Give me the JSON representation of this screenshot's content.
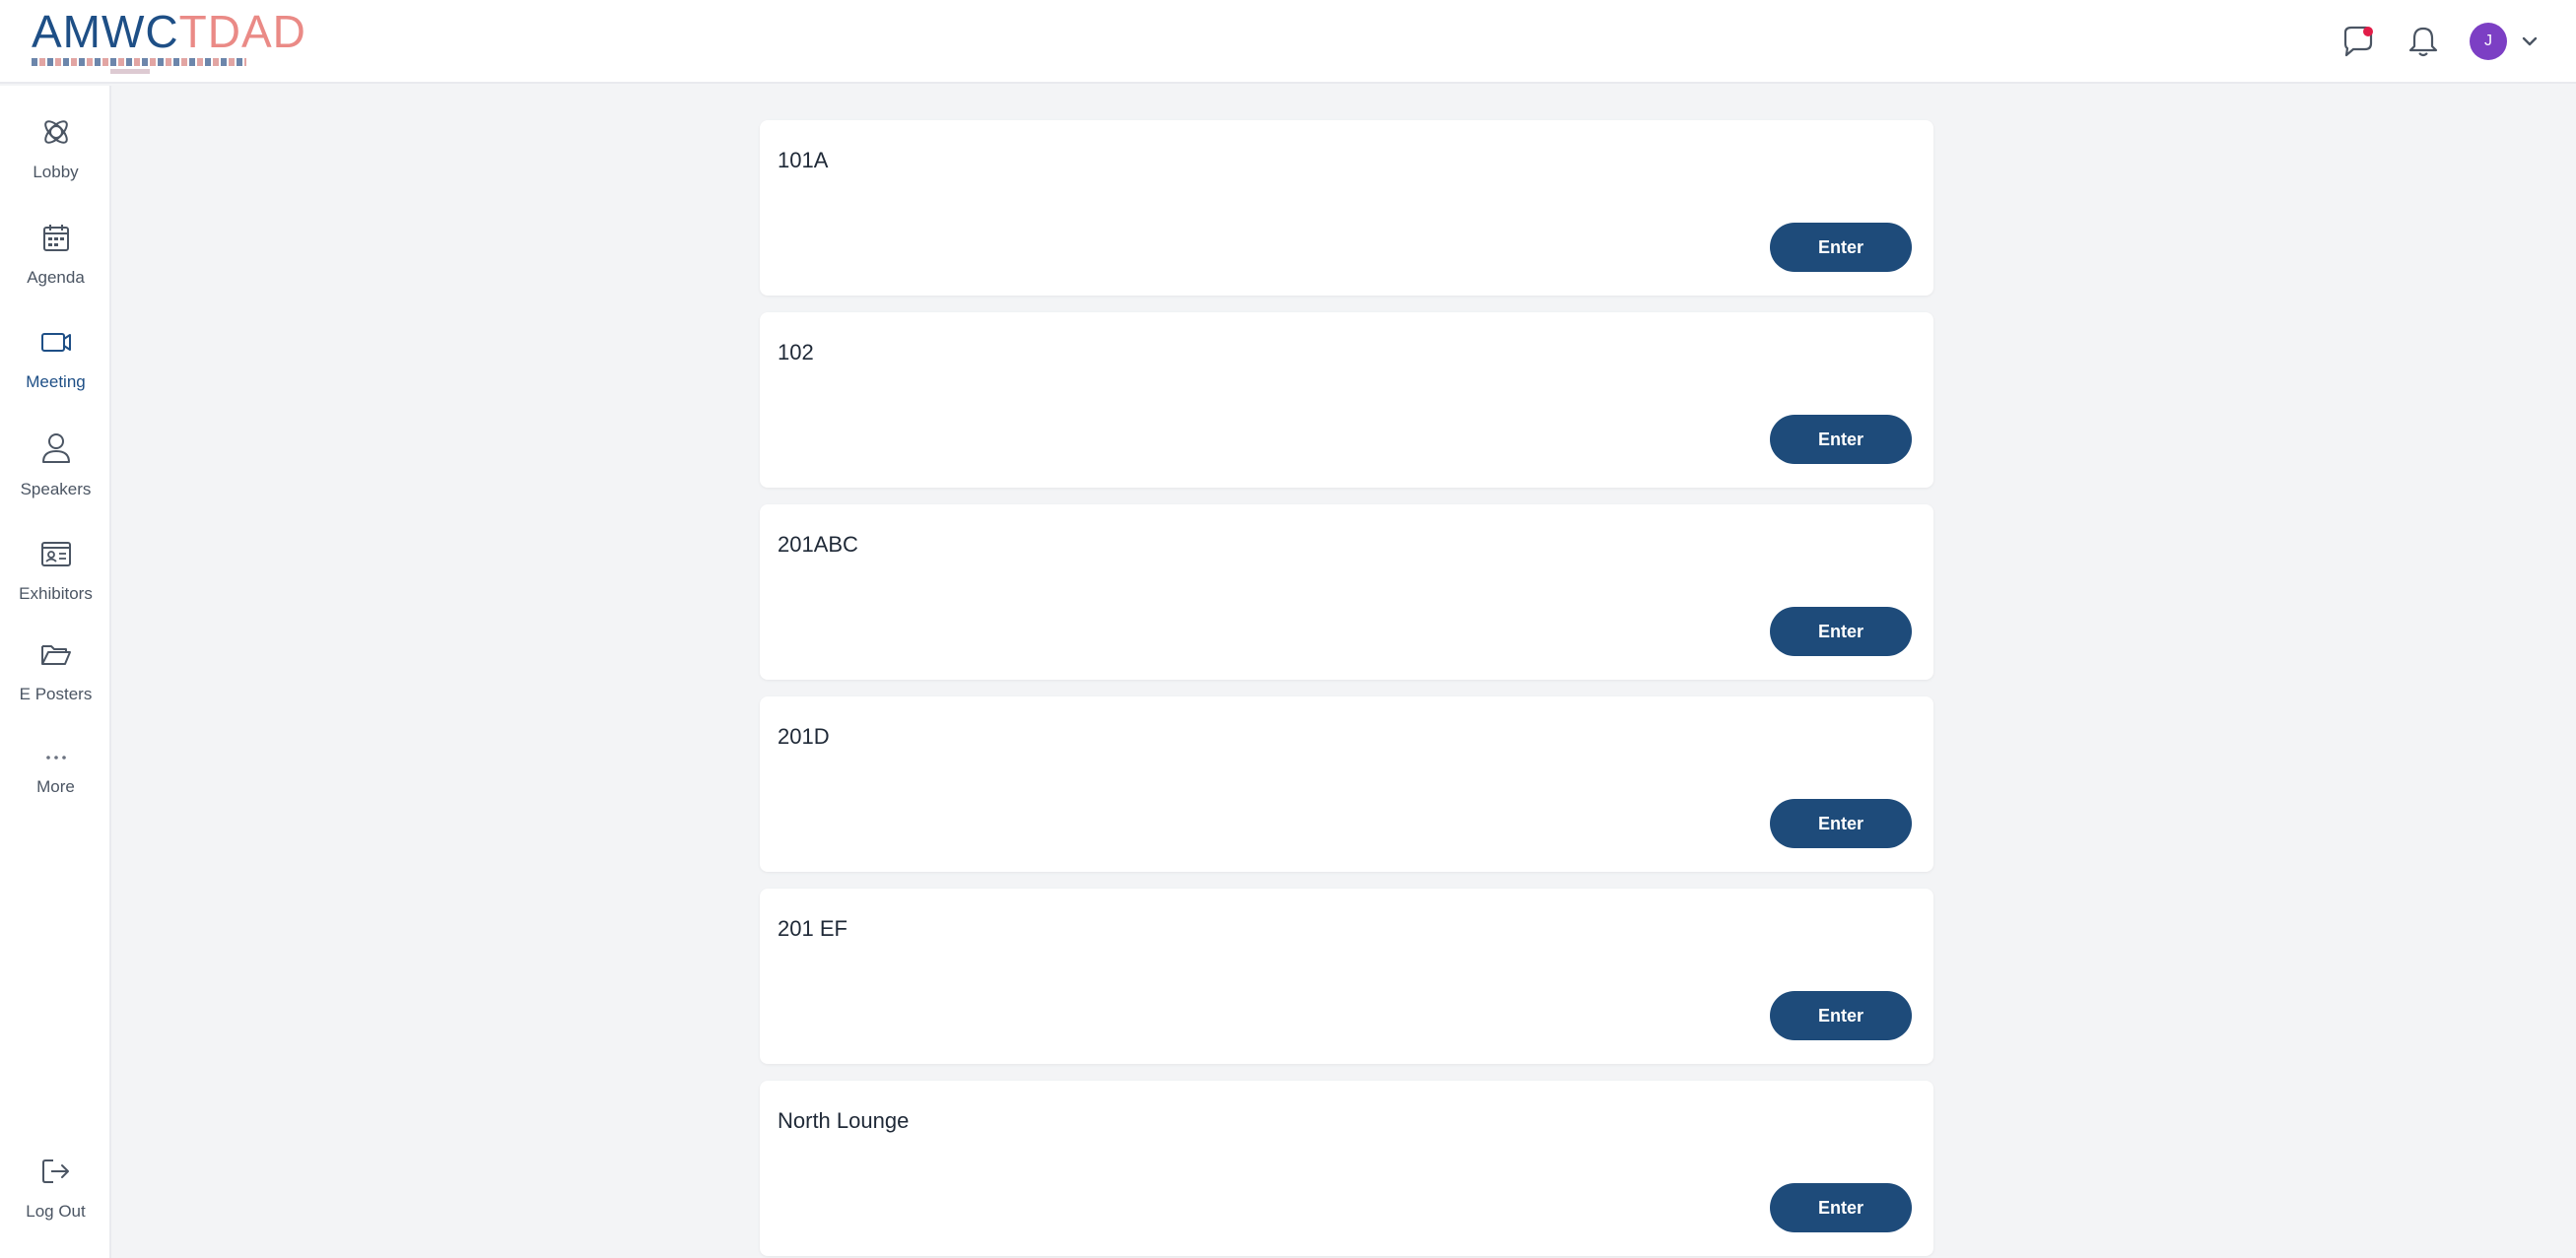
{
  "header": {
    "logo_text_main": "AMWC",
    "logo_text_accent": "TDAD",
    "icons": [
      "chat-icon",
      "bell-icon",
      "avatar",
      "chevron-down-icon"
    ],
    "avatar_initial": "J",
    "colors": {
      "brand": "#1e4f86",
      "accent": "#ea8a86",
      "avatar": "#7c3fc4",
      "badge": "#e11d48"
    }
  },
  "sidebar": {
    "items": [
      {
        "label": "Lobby",
        "icon": "lobby-icon"
      },
      {
        "label": "Agenda",
        "icon": "calendar-icon"
      },
      {
        "label": "Meeting",
        "icon": "video-icon"
      },
      {
        "label": "Speakers",
        "icon": "person-icon"
      },
      {
        "label": "Exhibitors",
        "icon": "id-card-icon"
      },
      {
        "label": "E Posters",
        "icon": "folder-icon"
      },
      {
        "label": "More",
        "icon": "more-icon"
      }
    ],
    "logout": {
      "label": "Log Out",
      "icon": "logout-icon"
    }
  },
  "rooms": [
    {
      "name": "101A",
      "button": "Enter"
    },
    {
      "name": "102",
      "button": "Enter"
    },
    {
      "name": "201ABC",
      "button": "Enter"
    },
    {
      "name": "201D",
      "button": "Enter"
    },
    {
      "name": "201 EF",
      "button": "Enter"
    },
    {
      "name": "North Lounge",
      "button": "Enter"
    }
  ],
  "colors": {
    "button": "#1e4b7a",
    "background": "#f3f4f6"
  }
}
